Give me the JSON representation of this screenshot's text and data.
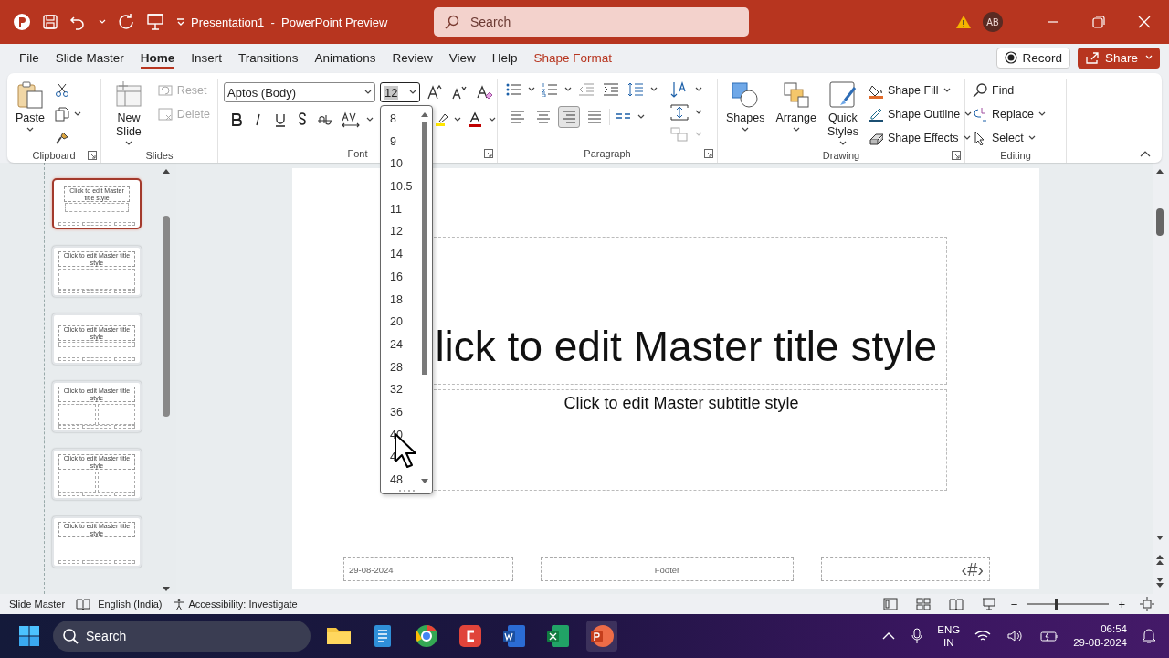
{
  "window": {
    "title": "Presentation1  -  PowerPoint Preview",
    "search_placeholder": "Search",
    "account_initials": "AB"
  },
  "menu_tabs": [
    {
      "label": "File",
      "kind": "plain",
      "selected": false
    },
    {
      "label": "Slide Master",
      "kind": "plain",
      "selected": false
    },
    {
      "label": "Home",
      "kind": "plain",
      "selected": true
    },
    {
      "label": "Insert",
      "kind": "plain",
      "selected": false
    },
    {
      "label": "Transitions",
      "kind": "plain",
      "selected": false
    },
    {
      "label": "Animations",
      "kind": "plain",
      "selected": false
    },
    {
      "label": "Review",
      "kind": "plain",
      "selected": false
    },
    {
      "label": "View",
      "kind": "plain",
      "selected": false
    },
    {
      "label": "Help",
      "kind": "plain",
      "selected": false
    },
    {
      "label": "Shape Format",
      "kind": "contextual",
      "selected": false
    }
  ],
  "record_button": "Record",
  "share_button": "Share",
  "clipboard_group": {
    "paste": "Paste",
    "group_label": "Clipboard"
  },
  "slides_group": {
    "new_slide": "New Slide",
    "commands": [
      {
        "label": "Reset",
        "disabled": true
      },
      {
        "label": "Delete",
        "disabled": true
      }
    ],
    "group_label": "Slides"
  },
  "font_group": {
    "font_name": "Aptos (Body)",
    "font_size": "12",
    "group_label": "Font"
  },
  "paragraph_group": {
    "alignments": [
      {
        "kind": "left",
        "selected": false
      },
      {
        "kind": "center",
        "selected": false
      },
      {
        "kind": "right",
        "selected": true
      },
      {
        "kind": "justify",
        "selected": false
      }
    ],
    "group_label": "Paragraph"
  },
  "drawing_group": {
    "large_buttons": [
      "Shapes",
      "Arrange",
      "Quick Styles"
    ],
    "commands": [
      "Shape Fill",
      "Shape Outline",
      "Shape Effects"
    ],
    "group_label": "Drawing"
  },
  "editing_group": {
    "commands": [
      "Find",
      "Replace",
      "Select"
    ],
    "group_label": "Editing"
  },
  "font_size_list": [
    "8",
    "9",
    "10",
    "10.5",
    "11",
    "12",
    "14",
    "16",
    "18",
    "20",
    "24",
    "28",
    "32",
    "36",
    "40",
    "4",
    "48"
  ],
  "thumbnails": [
    {
      "kind": "title",
      "title": "Click to edit Master title style",
      "selected": true
    },
    {
      "kind": "title_content",
      "title": "Click to edit Master title style",
      "selected": false
    },
    {
      "kind": "section",
      "title": "Click to edit Master title style",
      "selected": false
    },
    {
      "kind": "two_content",
      "title": "Click to edit Master title style",
      "selected": false
    },
    {
      "kind": "comparison",
      "title": "Click to edit Master title style",
      "selected": false
    },
    {
      "kind": "title_only",
      "title": "Click to edit Master title style",
      "selected": false
    }
  ],
  "slide": {
    "title": "lick to edit Master title style",
    "subtitle": "Click to edit Master subtitle style",
    "date": "29-08-2024",
    "footer": "Footer",
    "page_number": "‹#›"
  },
  "status_bar": {
    "view": "Slide Master",
    "language": "English (India)",
    "accessibility": "Accessibility: Investigate",
    "zoom_out": "−",
    "zoom_in": "+",
    "zoom": {
      "level": 0.35
    }
  },
  "taskbar": {
    "search_placeholder": "Search",
    "language": "ENG",
    "region": "IN",
    "time": "06:54",
    "date": "29-08-2024"
  }
}
